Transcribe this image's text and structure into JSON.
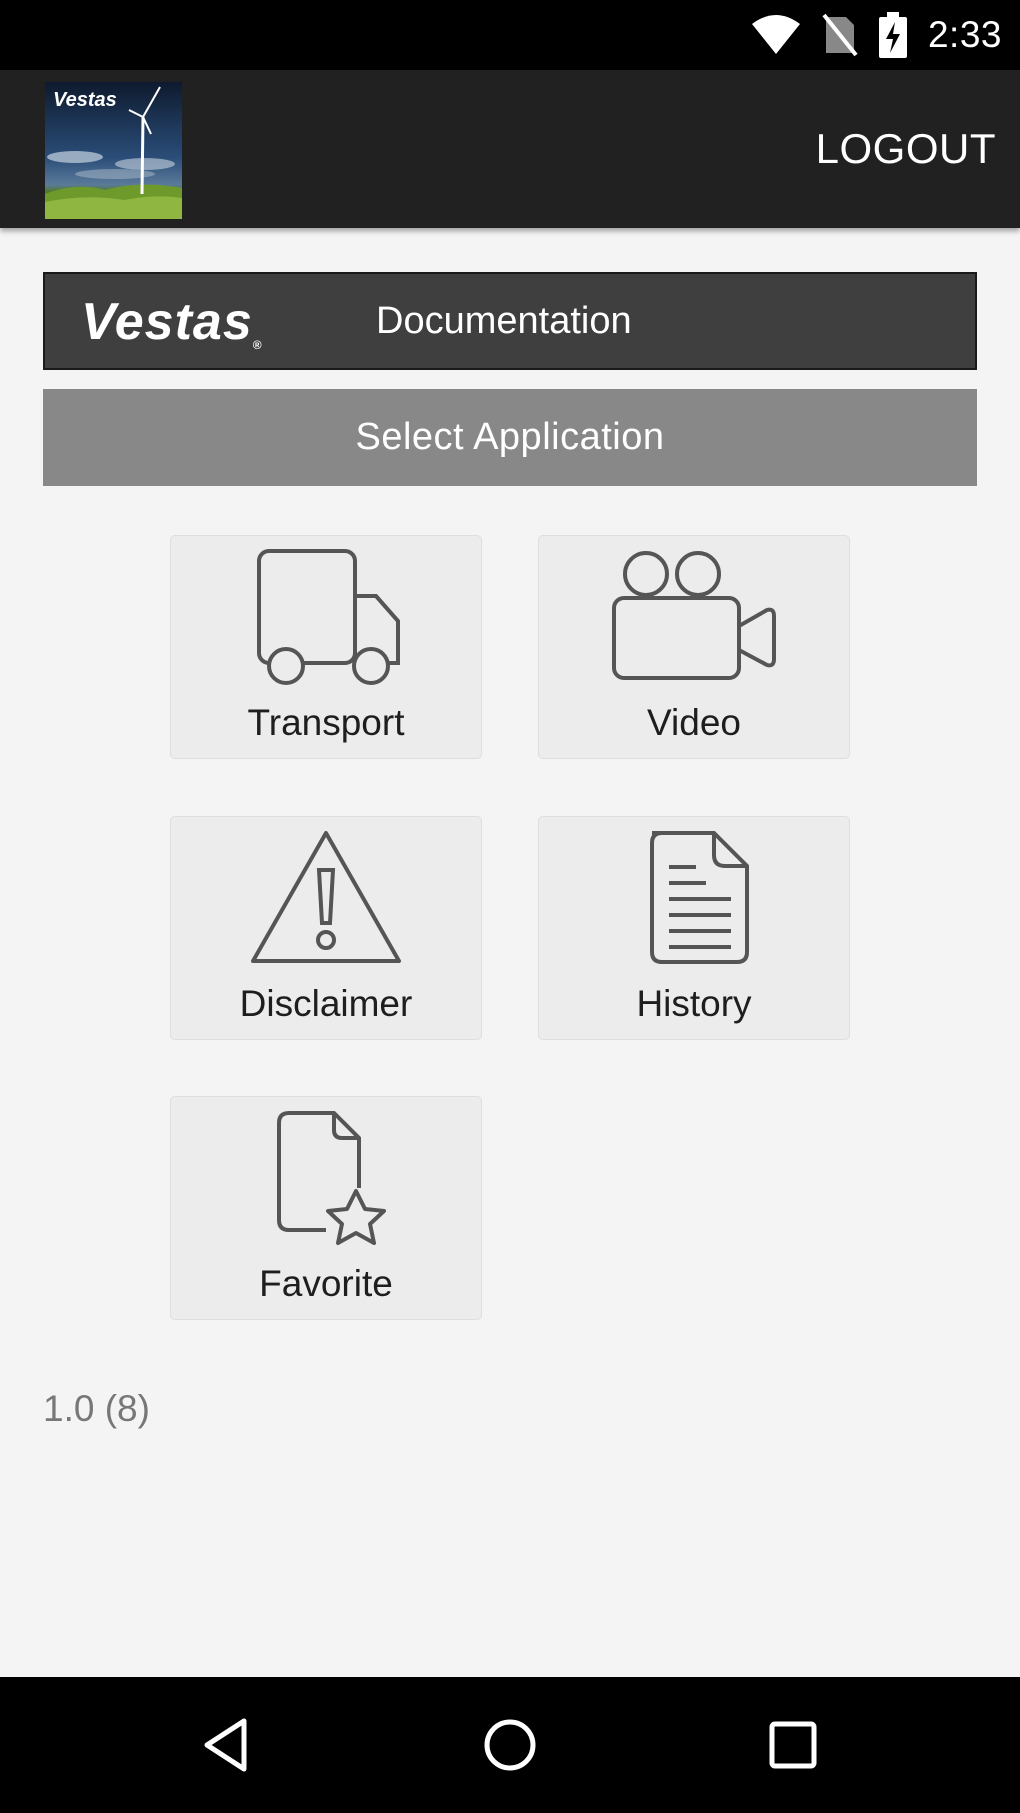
{
  "status_bar": {
    "time": "2:33",
    "icons": [
      "wifi-icon",
      "no-sim-icon",
      "battery-charging-icon"
    ]
  },
  "app_bar": {
    "logo_icon": "vestas-turbine-logo",
    "logo_text": "Vestas",
    "logout_label": "LOGOUT"
  },
  "banner": {
    "brand": "Vestas",
    "title": "Documentation"
  },
  "select_label": "Select Application",
  "tiles": [
    {
      "label": "Transport",
      "icon": "truck-icon"
    },
    {
      "label": "Video",
      "icon": "video-camera-icon"
    },
    {
      "label": "Disclaimer",
      "icon": "warning-icon"
    },
    {
      "label": "History",
      "icon": "document-icon"
    },
    {
      "label": "Favorite",
      "icon": "favorite-document-icon"
    }
  ],
  "version": "1.0 (8)",
  "nav": [
    "back-icon",
    "home-icon",
    "recents-icon"
  ],
  "colors": {
    "app_bar": "#212121",
    "banner": "#3f3f3f",
    "select_bar": "#888888",
    "background": "#f4f4f4",
    "tile": "#ececec",
    "icon_stroke": "#555555"
  }
}
